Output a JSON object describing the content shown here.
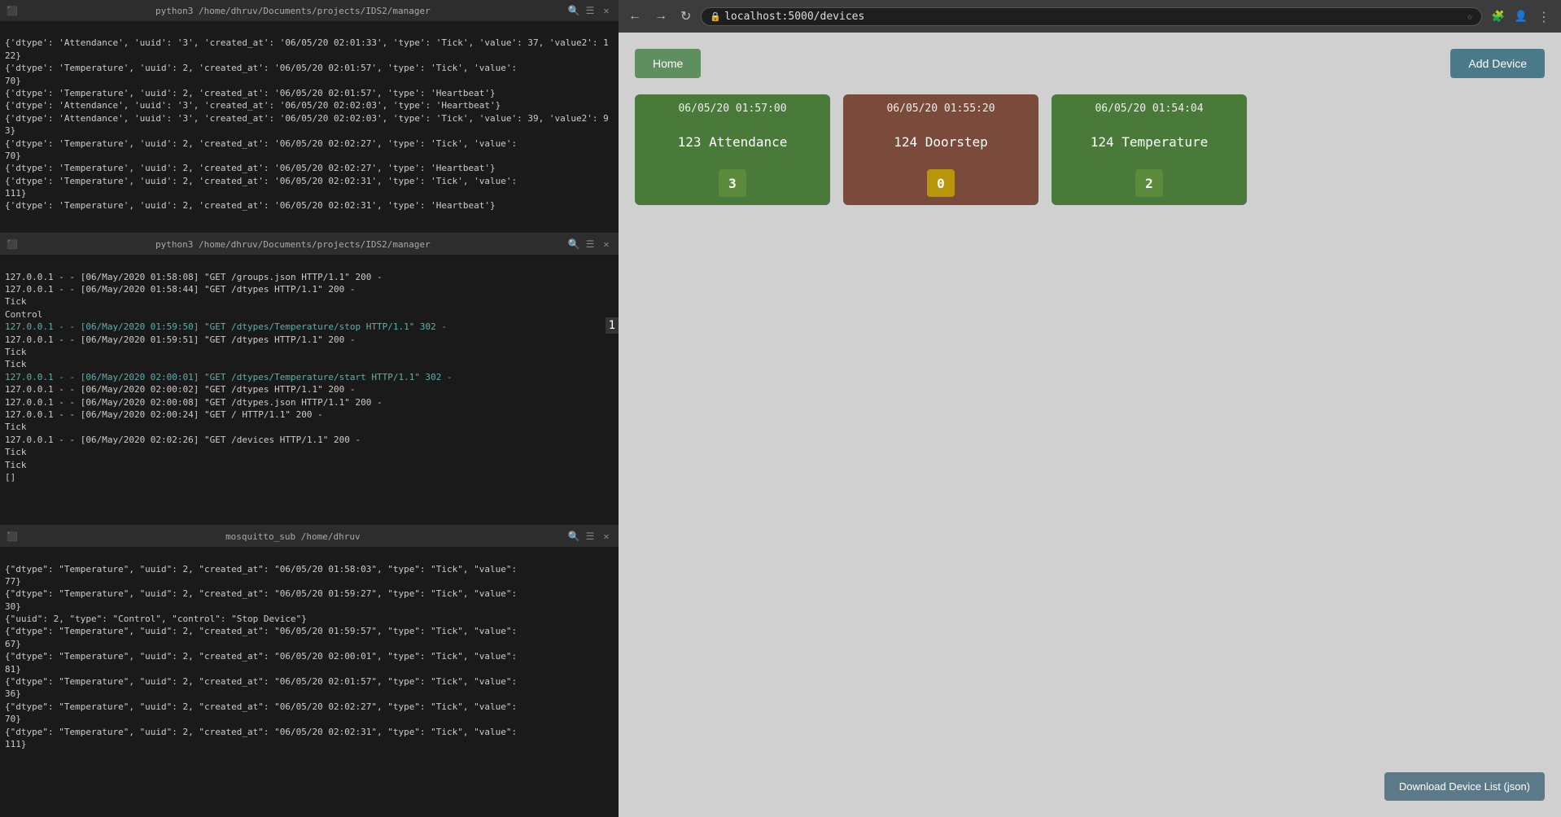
{
  "terminal": {
    "pane1": {
      "title": "python3 /home/dhruv/Documents/projects/IDS2/manager",
      "lines": [
        {
          "text": "{'dtype': 'Attendance', 'uuid': '3', 'created_at': '06/05/20 02:01:33', 'type': 'Tick', 'value': 37, 'value2': 122}",
          "color": "white"
        },
        {
          "text": "{'dtype': 'Temperature', 'uuid': 2, 'created_at': '06/05/20 02:01:57', 'type': 'Tick', 'value': 70}",
          "color": "white"
        },
        {
          "text": "{'dtype': 'Temperature', 'uuid': 2, 'created_at': '06/05/20 02:01:57', 'type': 'Heartbeat'}",
          "color": "white"
        },
        {
          "text": "{'dtype': 'Attendance', 'uuid': '3', 'created_at': '06/05/20 02:02:03', 'type': 'Heartbeat'}",
          "color": "white"
        },
        {
          "text": "{'dtype': 'Attendance', 'uuid': '3', 'created_at': '06/05/20 02:02:03', 'type': 'Tick', 'value': 39, 'value2': 93}",
          "color": "white"
        },
        {
          "text": "{'dtype': 'Temperature', 'uuid': 2, 'created_at': '06/05/20 02:02:27', 'type': 'Tick', 'value': 70}",
          "color": "white"
        },
        {
          "text": "{'dtype': 'Temperature', 'uuid': 2, 'created_at': '06/05/20 02:02:27', 'type': 'Heartbeat'}",
          "color": "white"
        },
        {
          "text": "{'dtype': 'Temperature', 'uuid': 2, 'created_at': '06/05/20 02:02:31', 'type': 'Tick', 'value': 111}",
          "color": "white"
        },
        {
          "text": "{'dtype': 'Temperature', 'uuid': 2, 'created_at': '06/05/20 02:02:31', 'type': 'Heartbeat'}",
          "color": "white"
        }
      ]
    },
    "pane2": {
      "title": "python3 /home/dhruv/Documents/projects/IDS2/manager",
      "lines": [
        {
          "text": "127.0.0.1 - - [06/May/2020 01:58:08] \"GET /groups.json HTTP/1.1\" 200 -",
          "color": "white"
        },
        {
          "text": "127.0.0.1 - - [06/May/2020 01:58:44] \"GET /dtypes HTTP/1.1\" 200 -",
          "color": "white"
        },
        {
          "text": "Tick",
          "color": "white"
        },
        {
          "text": "Control",
          "color": "white"
        },
        {
          "text": "127.0.0.1 - - [06/May/2020 01:59:50] \"GET /dtypes/Temperature/stop HTTP/1.1\" 302 -",
          "color": "cyan"
        },
        {
          "text": "127.0.0.1 - - [06/May/2020 01:59:51] \"GET /dtypes HTTP/1.1\" 200 -",
          "color": "white"
        },
        {
          "text": "Tick",
          "color": "white"
        },
        {
          "text": "Tick",
          "color": "white"
        },
        {
          "text": "127.0.0.1 - - [06/May/2020 02:00:01] \"GET /dtypes/Temperature/start HTTP/1.1\" 302 -",
          "color": "cyan"
        },
        {
          "text": "127.0.0.1 - - [06/May/2020 02:00:02] \"GET /dtypes HTTP/1.1\" 200 -",
          "color": "white"
        },
        {
          "text": "127.0.0.1 - - [06/May/2020 02:00:08] \"GET /dtypes.json HTTP/1.1\" 200 -",
          "color": "white"
        },
        {
          "text": "127.0.0.1 - - [06/May/2020 02:00:24] \"GET / HTTP/1.1\" 200 -",
          "color": "white"
        },
        {
          "text": "Tick",
          "color": "white"
        },
        {
          "text": "127.0.0.1 - - [06/May/2020 02:02:26] \"GET /devices HTTP/1.1\" 200 -",
          "color": "white"
        },
        {
          "text": "Tick",
          "color": "white"
        },
        {
          "text": "Tick",
          "color": "white"
        },
        {
          "text": "[]",
          "color": "white"
        }
      ]
    },
    "pane3": {
      "title": "mosquitto_sub /home/dhruv",
      "lines": [
        {
          "text": "{\"dtype\": \"Temperature\", \"uuid\": 2, \"created_at\": \"06/05/20 01:58:03\", \"type\": \"Tick\", \"value\": 77}",
          "color": "white"
        },
        {
          "text": "{\"dtype\": \"Temperature\", \"uuid\": 2, \"created_at\": \"06/05/20 01:59:27\", \"type\": \"Tick\", \"value\": 30}",
          "color": "white"
        },
        {
          "text": "{\"uuid\": 2, \"type\": \"Control\", \"control\": \"Stop Device\"}",
          "color": "white"
        },
        {
          "text": "{\"dtype\": \"Temperature\", \"uuid\": 2, \"created_at\": \"06/05/20 01:59:57\", \"type\": \"Tick\", \"value\": 67}",
          "color": "white"
        },
        {
          "text": "{\"dtype\": \"Temperature\", \"uuid\": 2, \"created_at\": \"06/05/20 02:00:01\", \"type\": \"Tick\", \"value\": 81}",
          "color": "white"
        },
        {
          "text": "{\"dtype\": \"Temperature\", \"uuid\": 2, \"created_at\": \"06/05/20 02:01:57\", \"type\": \"Tick\", \"value\": 36}",
          "color": "white"
        },
        {
          "text": "{\"dtype\": \"Temperature\", \"uuid\": 2, \"created_at\": \"06/05/20 02:02:27\", \"type\": \"Tick\", \"value\": 70}",
          "color": "white"
        },
        {
          "text": "{\"dtype\": \"Temperature\", \"uuid\": 2, \"created_at\": \"06/05/20 02:02:31\", \"type\": \"Tick\", \"value\": 111}",
          "color": "white"
        }
      ]
    }
  },
  "browser": {
    "url": "localhost:5000/devices",
    "nav": {
      "back": "←",
      "forward": "→",
      "reload": "↻"
    },
    "toolbar_icons": [
      "⭐",
      "⋮"
    ],
    "app": {
      "home_label": "Home",
      "add_device_label": "Add Device",
      "download_label": "Download Device List (json)",
      "devices": [
        {
          "id": "device-attendance",
          "timestamp": "06/05/20 01:57:00",
          "name": "123 Attendance",
          "badge": "3",
          "badge_type": "green",
          "card_color": "green"
        },
        {
          "id": "device-doorstep",
          "timestamp": "06/05/20 01:55:20",
          "name": "124 Doorstep",
          "badge": "0",
          "badge_type": "yellow",
          "card_color": "brown"
        },
        {
          "id": "device-temperature",
          "timestamp": "06/05/20 01:54:04",
          "name": "124 Temperature",
          "badge": "2",
          "badge_type": "green",
          "card_color": "green"
        }
      ]
    }
  }
}
